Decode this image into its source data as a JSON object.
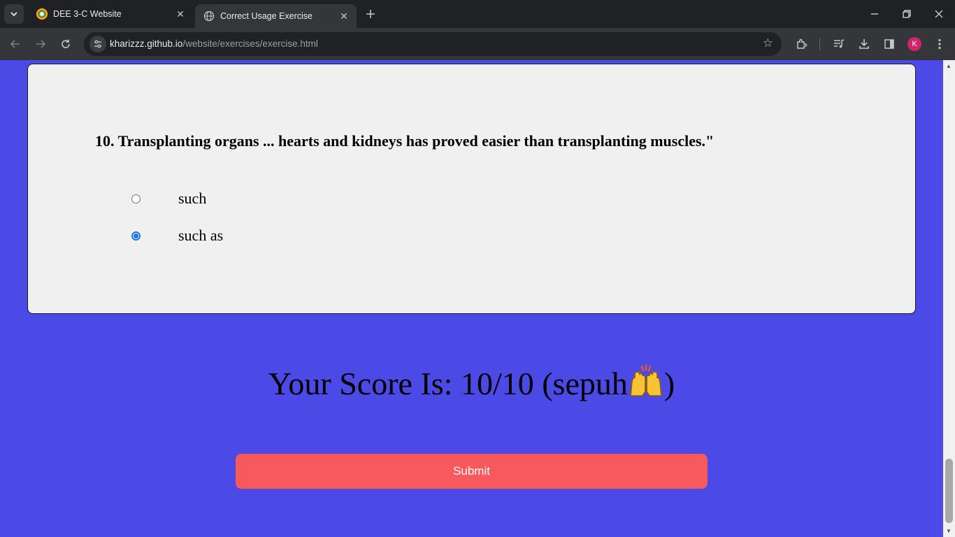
{
  "browser": {
    "tabs": [
      {
        "title": "DEE 3-C Website",
        "active": false
      },
      {
        "title": "Correct Usage Exercise",
        "active": true
      }
    ],
    "url": {
      "host": "kharizzz.github.io",
      "path": "/website/exercises/exercise.html"
    },
    "profile_initial": "K"
  },
  "question": {
    "text": "10. Transplanting organs ... hearts and kidneys has proved easier than transplanting muscles.\"",
    "options": [
      {
        "label": "such",
        "selected": false
      },
      {
        "label": "such as",
        "selected": true
      }
    ]
  },
  "result": {
    "score_text": "Your Score Is: 10/10 (sepuh",
    "score_suffix": ")"
  },
  "submit_label": "Submit",
  "colors": {
    "page_background": "#4b4ae6",
    "card_background": "#f0f0f0",
    "submit_button": "#f8595c",
    "radio_accent": "#1a73e8"
  }
}
